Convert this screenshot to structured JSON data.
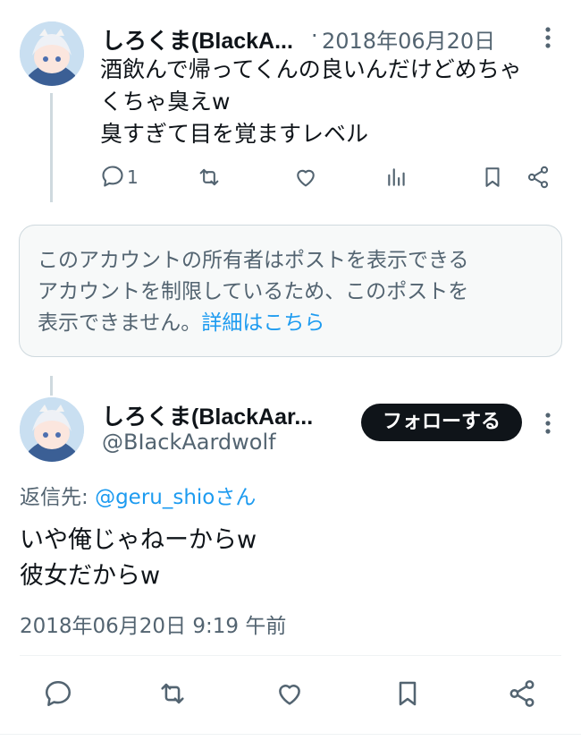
{
  "tweet1": {
    "display_name": "しろくま(BlackA...",
    "separator": "·",
    "date": "2018年06月20日",
    "lines": [
      "酒飲んで帰ってくんの良いんだけどめちゃ",
      "くちゃ臭えw",
      "臭すぎて目を覚ますレベル"
    ],
    "reply_count": "1",
    "icons": [
      "reply-icon",
      "retweet-icon",
      "like-icon",
      "views-icon",
      "bookmark-icon",
      "share-icon",
      "more-icon"
    ]
  },
  "notice": {
    "text": "このアカウントの所有者はポストを表示できるアカウントを制限しているため、このポストを表示できません。",
    "line1": "このアカウントの所有者はポストを表示できる",
    "line2": "アカウントを制限しているため、このポストを",
    "line3": "表示できません。",
    "link": "詳細はこちら"
  },
  "tweet2": {
    "display_name": "しろくま(BlackAar...",
    "handle": "@BIackAardwolf",
    "follow_label": "フォローする",
    "reply_to_prefix": "返信先: ",
    "reply_to_user": "@geru_shioさん",
    "lines": [
      "いや俺じゃねーからw",
      "彼女だからw"
    ],
    "timestamp": "2018年06月20日 9:19 午前",
    "icons": [
      "reply-icon",
      "retweet-icon",
      "like-icon",
      "bookmark-icon",
      "share-icon",
      "more-icon"
    ]
  },
  "colors": {
    "text": "#0f1419",
    "muted": "#536471",
    "link": "#1d9bf0",
    "border": "#cfd9de",
    "notice_bg": "#f7f9f9"
  }
}
